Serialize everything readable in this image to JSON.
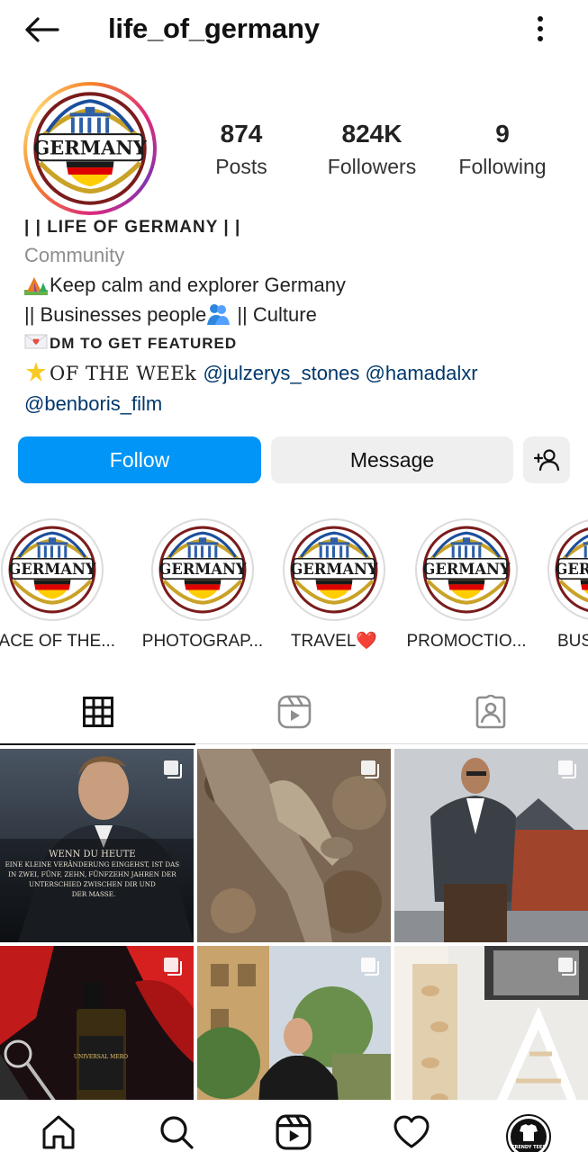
{
  "header": {
    "username": "life_of_germany",
    "back_icon": "arrow-left-icon",
    "more_icon": "more-vertical-icon"
  },
  "profile": {
    "avatar_text": "GERMANY",
    "stats": {
      "posts": {
        "value": "874",
        "label": "Posts"
      },
      "followers": {
        "value": "824K",
        "label": "Followers"
      },
      "following": {
        "value": "9",
        "label": "Following"
      }
    }
  },
  "bio": {
    "name": "| |  LIFE OF GERMANY | |",
    "category": "Community",
    "line1": "Keep calm and explorer Germany",
    "line2": " || Businesses people",
    "line2b": " || Culture",
    "line3": "DM TO GET FEATURED",
    "line4_prefix": "OF THE WEEk ",
    "mention1": "@julzerys_stones",
    "mention2": "@hamadalxr",
    "mention3": "@benboris_film"
  },
  "actions": {
    "follow": "Follow",
    "message": "Message",
    "add_user_icon": "add-user-icon"
  },
  "highlights": [
    {
      "label": "FACE OF THE...",
      "logo_text": "GERMANY"
    },
    {
      "label": "PHOTOGRAP...",
      "logo_text": "GERMANY"
    },
    {
      "label": "TRAVEL❤️",
      "logo_text": "GERMANY"
    },
    {
      "label": "PROMOCTIO...",
      "logo_text": "GERMANY"
    },
    {
      "label": "BUS",
      "logo_text": "GERMANY"
    }
  ],
  "tabs": [
    {
      "name": "grid",
      "icon": "grid-icon",
      "active": true
    },
    {
      "name": "reels",
      "icon": "reels-icon",
      "active": false
    },
    {
      "name": "tagged",
      "icon": "tagged-user-icon",
      "active": false
    }
  ],
  "posts": {
    "post1_text": [
      "WENN DU HEUTE",
      "EINE KLEINE VERÄNDERUNG EINGEHST, IST DAS",
      "IN ZWEI, FÜNF, ZEHN, FÜNFZEHN JAHREN DER",
      "UNTERSCHIED ZWISCHEN DIR UND",
      "DER MASSE."
    ],
    "post4_label": "UNIVERSAL MERO"
  },
  "bottom_nav": [
    {
      "name": "home",
      "icon": "home-icon"
    },
    {
      "name": "search",
      "icon": "search-icon"
    },
    {
      "name": "reels",
      "icon": "reels-icon"
    },
    {
      "name": "activity",
      "icon": "heart-icon"
    },
    {
      "name": "profile",
      "icon": "profile-avatar",
      "avatar_text": "TRENDY TEES"
    }
  ],
  "colors": {
    "accent": "#0095f6",
    "secondary_button": "#efefef",
    "mention": "#00376b",
    "muted": "#8e8e8e",
    "germany_black": "#1a1a1a",
    "germany_red": "#dd0000",
    "germany_gold": "#ffce00"
  }
}
